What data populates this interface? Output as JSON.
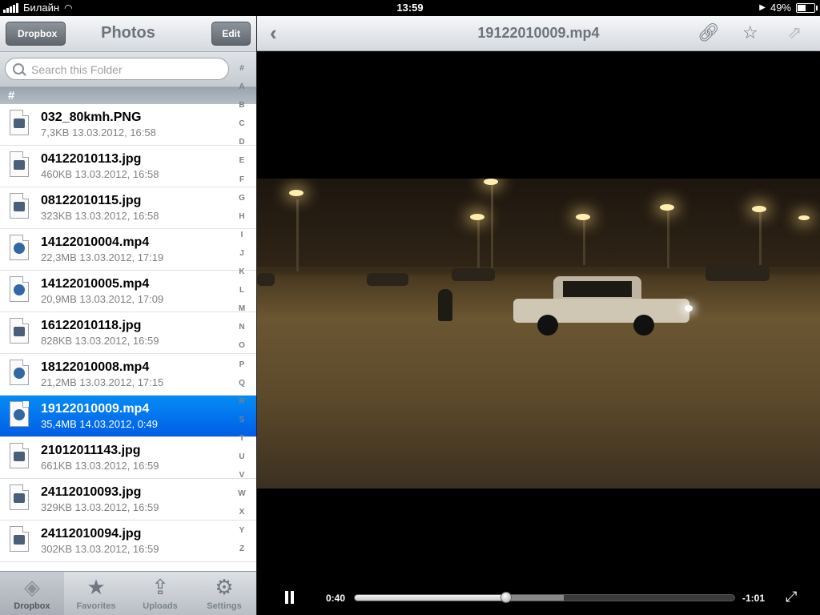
{
  "status": {
    "carrier": "Билайн",
    "time": "13:59",
    "battery": "49%",
    "battery_level": 0.49
  },
  "sidebar": {
    "back_label": "Dropbox",
    "title": "Photos",
    "edit_label": "Edit",
    "search_placeholder": "Search this Folder",
    "section_header": "#",
    "index": [
      "#",
      "A",
      "B",
      "C",
      "D",
      "E",
      "F",
      "G",
      "H",
      "I",
      "J",
      "K",
      "L",
      "M",
      "N",
      "O",
      "P",
      "Q",
      "R",
      "S",
      "T",
      "U",
      "V",
      "W",
      "X",
      "Y",
      "Z"
    ],
    "files": [
      {
        "name": "032_80kmh.PNG",
        "meta": "7,3KB  13.03.2012, 16:58",
        "kind": "image",
        "selected": false
      },
      {
        "name": "04122010113.jpg",
        "meta": "460KB  13.03.2012, 16:58",
        "kind": "image",
        "selected": false
      },
      {
        "name": "08122010115.jpg",
        "meta": "323KB  13.03.2012, 16:58",
        "kind": "image",
        "selected": false
      },
      {
        "name": "14122010004.mp4",
        "meta": "22,3MB  13.03.2012, 17:19",
        "kind": "video",
        "selected": false
      },
      {
        "name": "14122010005.mp4",
        "meta": "20,9MB  13.03.2012, 17:09",
        "kind": "video",
        "selected": false
      },
      {
        "name": "16122010118.jpg",
        "meta": "828KB  13.03.2012, 16:59",
        "kind": "image",
        "selected": false
      },
      {
        "name": "18122010008.mp4",
        "meta": "21,2MB  13.03.2012, 17:15",
        "kind": "video",
        "selected": false
      },
      {
        "name": "19122010009.mp4",
        "meta": "35,4MB  14.03.2012, 0:49",
        "kind": "video",
        "selected": true
      },
      {
        "name": "21012011143.jpg",
        "meta": "661KB  13.03.2012, 16:59",
        "kind": "image",
        "selected": false
      },
      {
        "name": "24112010093.jpg",
        "meta": "329KB  13.03.2012, 16:59",
        "kind": "image",
        "selected": false
      },
      {
        "name": "24112010094.jpg",
        "meta": "302KB  13.03.2012, 16:59",
        "kind": "image",
        "selected": false
      }
    ]
  },
  "tabs": [
    {
      "label": "Dropbox",
      "icon": "dropbox-icon",
      "glyph": "◈",
      "active": true
    },
    {
      "label": "Favorites",
      "icon": "star-icon",
      "glyph": "★",
      "active": false
    },
    {
      "label": "Uploads",
      "icon": "upload-icon",
      "glyph": "⇪",
      "active": false
    },
    {
      "label": "Settings",
      "icon": "gear-icon",
      "glyph": "⚙",
      "active": false
    }
  ],
  "viewer": {
    "title": "19122010009.mp4",
    "elapsed": "0:40",
    "remaining": "-1:01",
    "progress": 0.4,
    "buffered": 0.55
  }
}
